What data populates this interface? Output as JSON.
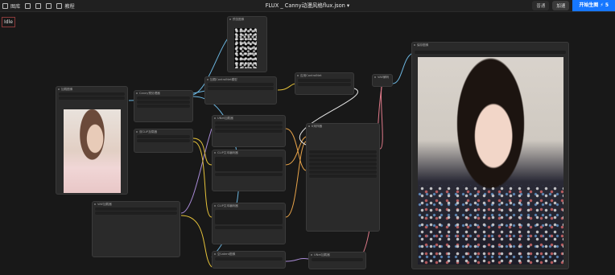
{
  "topbar": {
    "items": [
      "图库",
      "",
      "",
      "",
      "教程"
    ],
    "title": "FLUX _ Canny动漫风格flux.json",
    "share_label": "普通",
    "accel_label": "加速",
    "run_label": "开始生图",
    "run_count": "5"
  },
  "status": "Idle",
  "node_titles": {
    "load_image": "加载图像",
    "canny": "Canny预处理器",
    "preview": "预览图像",
    "controlnet_loader": "加载ControlNet模型",
    "dual_clip": "双CLIP加载器",
    "clip_text_pos": "CLIP文本编码器",
    "clip_text_neg": "CLIP文本编码器",
    "apply_controlnet": "应用ControlNet",
    "ksampler": "K采样器",
    "unet": "UNet加载器",
    "vae_decode": "VAE解码",
    "vae_loader": "VAE加载器",
    "save_image": "保存图像",
    "empty_latent": "空Latent图像"
  },
  "colors": {
    "accent": "#1677ff",
    "wire_blue": "#6cb6e0",
    "wire_yellow": "#e5c23a",
    "wire_pink": "#e07a8a",
    "wire_purple": "#a98bd6",
    "wire_orange": "#e8a44a"
  },
  "icons": [
    "layers-icon",
    "folder-icon",
    "download-icon",
    "upload-icon",
    "book-icon",
    "lightning-icon"
  ]
}
